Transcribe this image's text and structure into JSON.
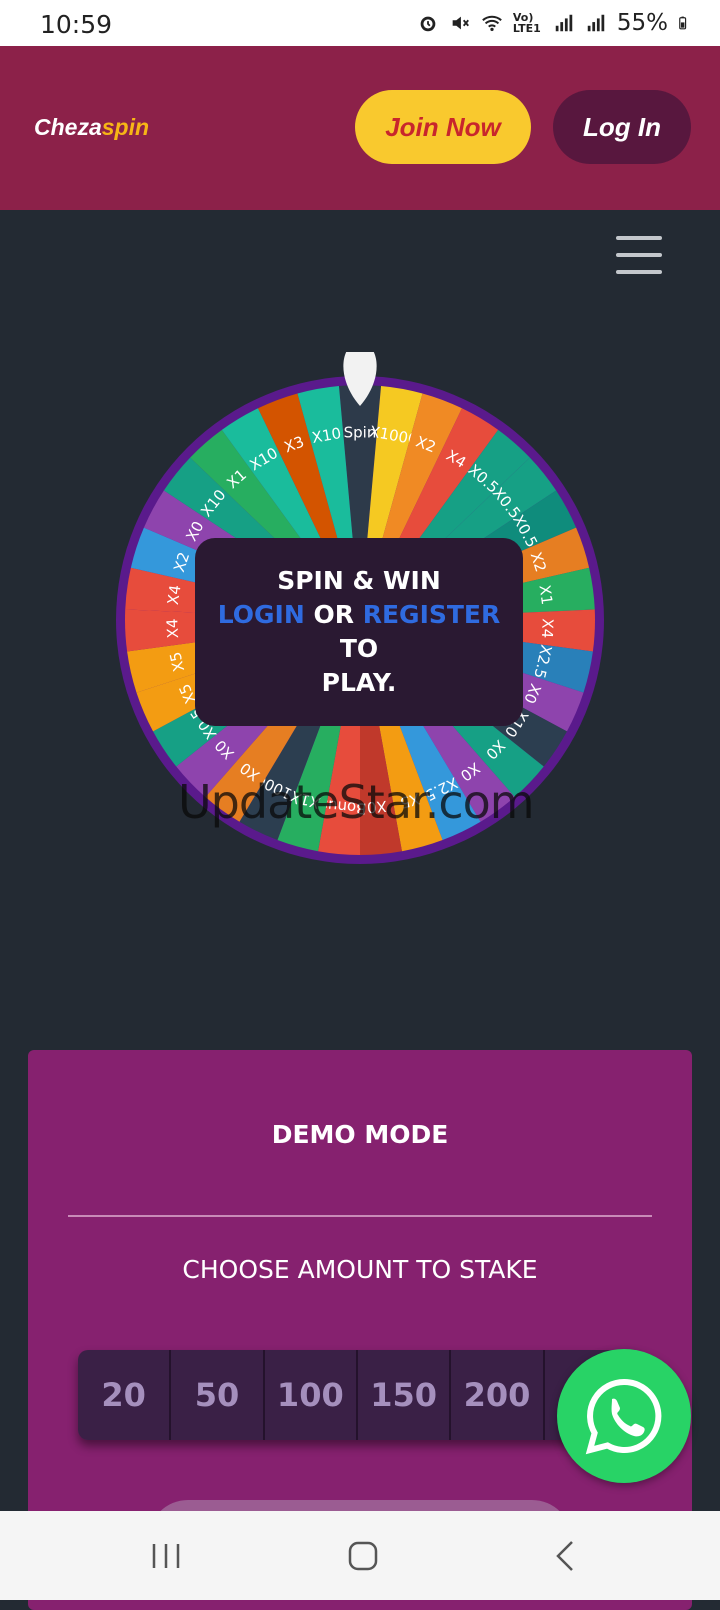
{
  "status_bar": {
    "time": "10:59",
    "network": "Vo) LTE1",
    "battery": "55%",
    "icons": [
      "alarm-icon",
      "mute-icon",
      "wifi-icon",
      "lte-icon",
      "signal-icon",
      "signal-icon",
      "battery-icon"
    ]
  },
  "header": {
    "logo_main": "Cheza",
    "logo_accent": "spin",
    "join_label": "Join Now",
    "login_label": "Log In",
    "colors": {
      "header_bg": "#8c2149",
      "join_bg": "#f9c92e",
      "login_bg": "#58173e"
    }
  },
  "menu": {
    "icon": "hamburger-menu-icon"
  },
  "wheel": {
    "segments": [
      "Spin",
      "X1000",
      "X2",
      "X4",
      "X0.5",
      "X0.5",
      "X0.5",
      "X2",
      "X1",
      "X4",
      "X2.5",
      "X0",
      "X10",
      "X0",
      "X0",
      "X2.5",
      "X5",
      "X0",
      "Bonus",
      "X1",
      "X1000",
      "X0",
      "X0",
      "X0.5",
      "X5",
      "X5",
      "X4",
      "X4",
      "X2",
      "X0",
      "X10",
      "X1",
      "X10",
      "X3",
      "X10"
    ],
    "pointer_icon": "wheel-pointer-icon"
  },
  "overlay": {
    "line1": "SPIN & WIN",
    "login_link": "LOGIN",
    "or_text": "OR",
    "register_link": "REGISTER",
    "to_text": "TO",
    "line3": "PLAY."
  },
  "watermark": "UpdateStar.com",
  "demo": {
    "title": "DEMO MODE",
    "stake_label": "CHOOSE AMOUNT TO STAKE",
    "stakes": [
      "20",
      "50",
      "100",
      "150",
      "200"
    ]
  },
  "whatsapp": {
    "icon": "whatsapp-icon"
  },
  "nav": {
    "icons": [
      "recent-apps-icon",
      "home-icon",
      "back-icon"
    ]
  }
}
